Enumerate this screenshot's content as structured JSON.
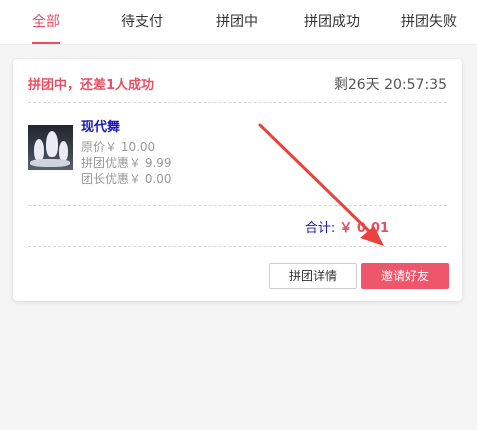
{
  "tabs": [
    {
      "label": "全部",
      "active": true
    },
    {
      "label": "待支付",
      "active": false
    },
    {
      "label": "拼团中",
      "active": false
    },
    {
      "label": "拼团成功",
      "active": false
    },
    {
      "label": "拼团失败",
      "active": false
    }
  ],
  "order": {
    "status": "拼团中，还差1人成功",
    "countdown": "剩26天 20:57:35",
    "product_name": "现代舞",
    "original_price": "原价￥ 10.00",
    "group_discount": "拼团优惠￥ 9.99",
    "leader_discount": "团长优惠￥ 0.00",
    "total_label": "合计:",
    "total_value": "￥ 0.01",
    "detail_button": "拼团详情",
    "invite_button": "邀请好友"
  },
  "colors": {
    "accent": "#e84f63",
    "invite_button": "#f0566b",
    "product_name": "#1a1ab0",
    "annotation_arrow": "#e8433f"
  },
  "annotation": {
    "type": "arrow-icon",
    "points_to": "invite-friends-button"
  }
}
